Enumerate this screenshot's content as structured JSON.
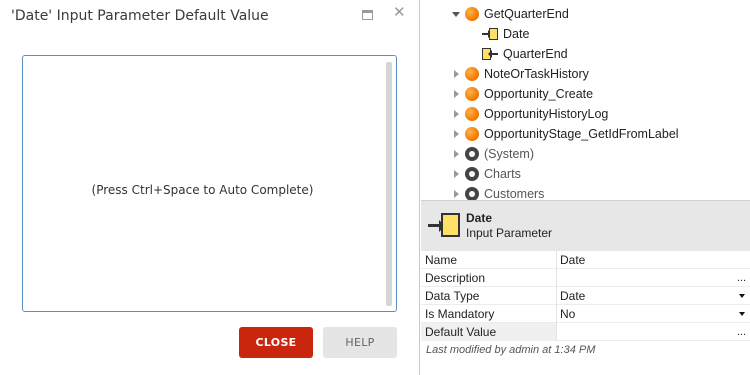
{
  "dialog": {
    "title": "'Date' Input Parameter Default Value",
    "maximize_icon": "maximize-icon",
    "close_icon": "close-icon",
    "close_glyph": "✕",
    "editor_hint": "(Press Ctrl+Space to Auto Complete)",
    "close_button": "CLOSE",
    "help_button": "HELP",
    "accent_color": "#c9260d"
  },
  "tree": {
    "items": [
      {
        "label": "GetQuarterEnd",
        "icon": "action-icon",
        "expanded": true
      },
      {
        "label": "Date",
        "icon": "input-parameter-icon",
        "selected": true
      },
      {
        "label": "QuarterEnd",
        "icon": "output-parameter-icon"
      },
      {
        "label": "NoteOrTaskHistory",
        "icon": "action-icon"
      },
      {
        "label": "Opportunity_Create",
        "icon": "action-icon"
      },
      {
        "label": "OpportunityHistoryLog",
        "icon": "action-icon"
      },
      {
        "label": "OpportunityStage_GetIdFromLabel",
        "icon": "action-icon"
      },
      {
        "label": "(System)",
        "icon": "module-icon"
      },
      {
        "label": "Charts",
        "icon": "module-icon"
      },
      {
        "label": "Customers",
        "icon": "module-icon"
      }
    ]
  },
  "properties": {
    "header_name": "Date",
    "header_type": "Input Parameter",
    "rows": [
      {
        "key": "Name",
        "value": "Date"
      },
      {
        "key": "Description",
        "value": "",
        "button": "..."
      },
      {
        "key": "Data Type",
        "value": "Date",
        "dropdown": true
      },
      {
        "key": "Is Mandatory",
        "value": "No",
        "dropdown": true
      },
      {
        "key": "Default Value",
        "value": "",
        "button": "..."
      }
    ],
    "modified": "Last modified by admin at 1:34 PM"
  }
}
